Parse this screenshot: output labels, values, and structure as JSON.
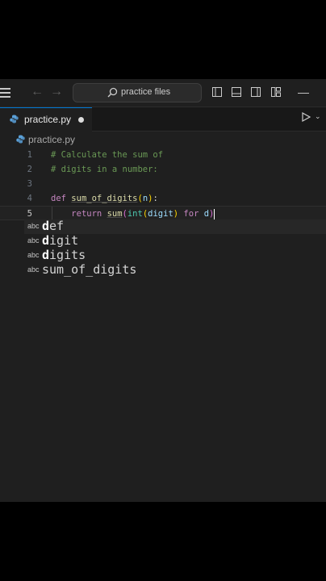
{
  "titlebar": {
    "search_placeholder": "practice files"
  },
  "tab": {
    "name": "practice.py",
    "modified": true
  },
  "breadcrumb": {
    "file": "practice.py"
  },
  "editor": {
    "lines": [
      {
        "number": "1",
        "tokens": [
          {
            "t": "# Calculate the sum of",
            "c": "cmt"
          }
        ]
      },
      {
        "number": "2",
        "tokens": [
          {
            "t": "# digits in a number:",
            "c": "cmt"
          }
        ]
      },
      {
        "number": "3",
        "tokens": []
      },
      {
        "number": "4",
        "tokens": [
          {
            "t": "def ",
            "c": "kw"
          },
          {
            "t": "sum_of_digits",
            "c": "fn"
          },
          {
            "t": "(",
            "c": "br"
          },
          {
            "t": "n",
            "c": "var"
          },
          {
            "t": ")",
            "c": "br"
          },
          {
            "t": ":",
            "c": "plain"
          }
        ]
      },
      {
        "number": "5",
        "tokens": [
          {
            "t": "    ",
            "c": "plain"
          },
          {
            "t": "return ",
            "c": "kw"
          },
          {
            "t": "sum",
            "c": "fn"
          },
          {
            "t": "(",
            "c": "br2"
          },
          {
            "t": "int",
            "c": "bi"
          },
          {
            "t": "(",
            "c": "br"
          },
          {
            "t": "digit",
            "c": "var"
          },
          {
            "t": ") ",
            "c": "br"
          },
          {
            "t": "for ",
            "c": "kw"
          },
          {
            "t": "d",
            "c": "var"
          },
          {
            "t": ")",
            "c": "br2"
          }
        ]
      }
    ],
    "active_line": "5"
  },
  "suggestions": [
    {
      "kind": "abc",
      "label": "def",
      "match": "d"
    },
    {
      "kind": "abc",
      "label": "digit",
      "match": "d"
    },
    {
      "kind": "abc",
      "label": "digits",
      "match": "d"
    },
    {
      "kind": "abc",
      "label": "sum_of_digits",
      "match": ""
    }
  ],
  "icons": {
    "menu": "hamburger-icon",
    "back": "arrow-left-icon",
    "forward": "arrow-right-icon",
    "search": "search-icon",
    "run": "play-icon",
    "file": "python-file-icon"
  }
}
